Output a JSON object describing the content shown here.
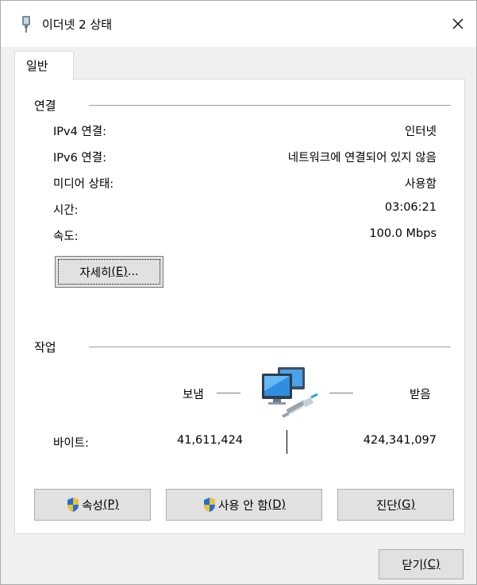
{
  "window": {
    "title": "이더넷 2 상태"
  },
  "tabs": [
    {
      "label": "일반"
    }
  ],
  "connection": {
    "section_title": "연결",
    "rows": [
      {
        "label": "IPv4 연결:",
        "value": "인터넷"
      },
      {
        "label": "IPv6 연결:",
        "value": "네트워크에 연결되어 있지 않음"
      },
      {
        "label": "미디어 상태:",
        "value": "사용함"
      },
      {
        "label": "시간:",
        "value": "03:06:21"
      },
      {
        "label": "속도:",
        "value": "100.0 Mbps"
      }
    ],
    "details_button": {
      "text": "자세히",
      "mnemonic": "(E)",
      "suffix": "..."
    }
  },
  "activity": {
    "section_title": "작업",
    "sent_label": "보냄",
    "received_label": "받음",
    "bytes_label": "바이트:",
    "bytes_sent": "41,611,424",
    "bytes_received": "424,341,097"
  },
  "buttons": {
    "properties": {
      "text": "속성",
      "mnemonic": "(P)"
    },
    "disable": {
      "text": "사용 안 함",
      "mnemonic": "(D)"
    },
    "diagnose": {
      "text": "진단",
      "mnemonic": "(G)"
    },
    "close": {
      "text": "닫기",
      "mnemonic": "(C)"
    }
  },
  "colors": {
    "shield_blue": "#1e6fd9",
    "shield_yellow": "#f2c12e",
    "panel_border": "#d9d9d9"
  },
  "icons": {
    "title": "network-adapter-icon",
    "close": "close-icon",
    "activity": "network-computers-icon",
    "button_shield": "uac-shield-icon"
  }
}
